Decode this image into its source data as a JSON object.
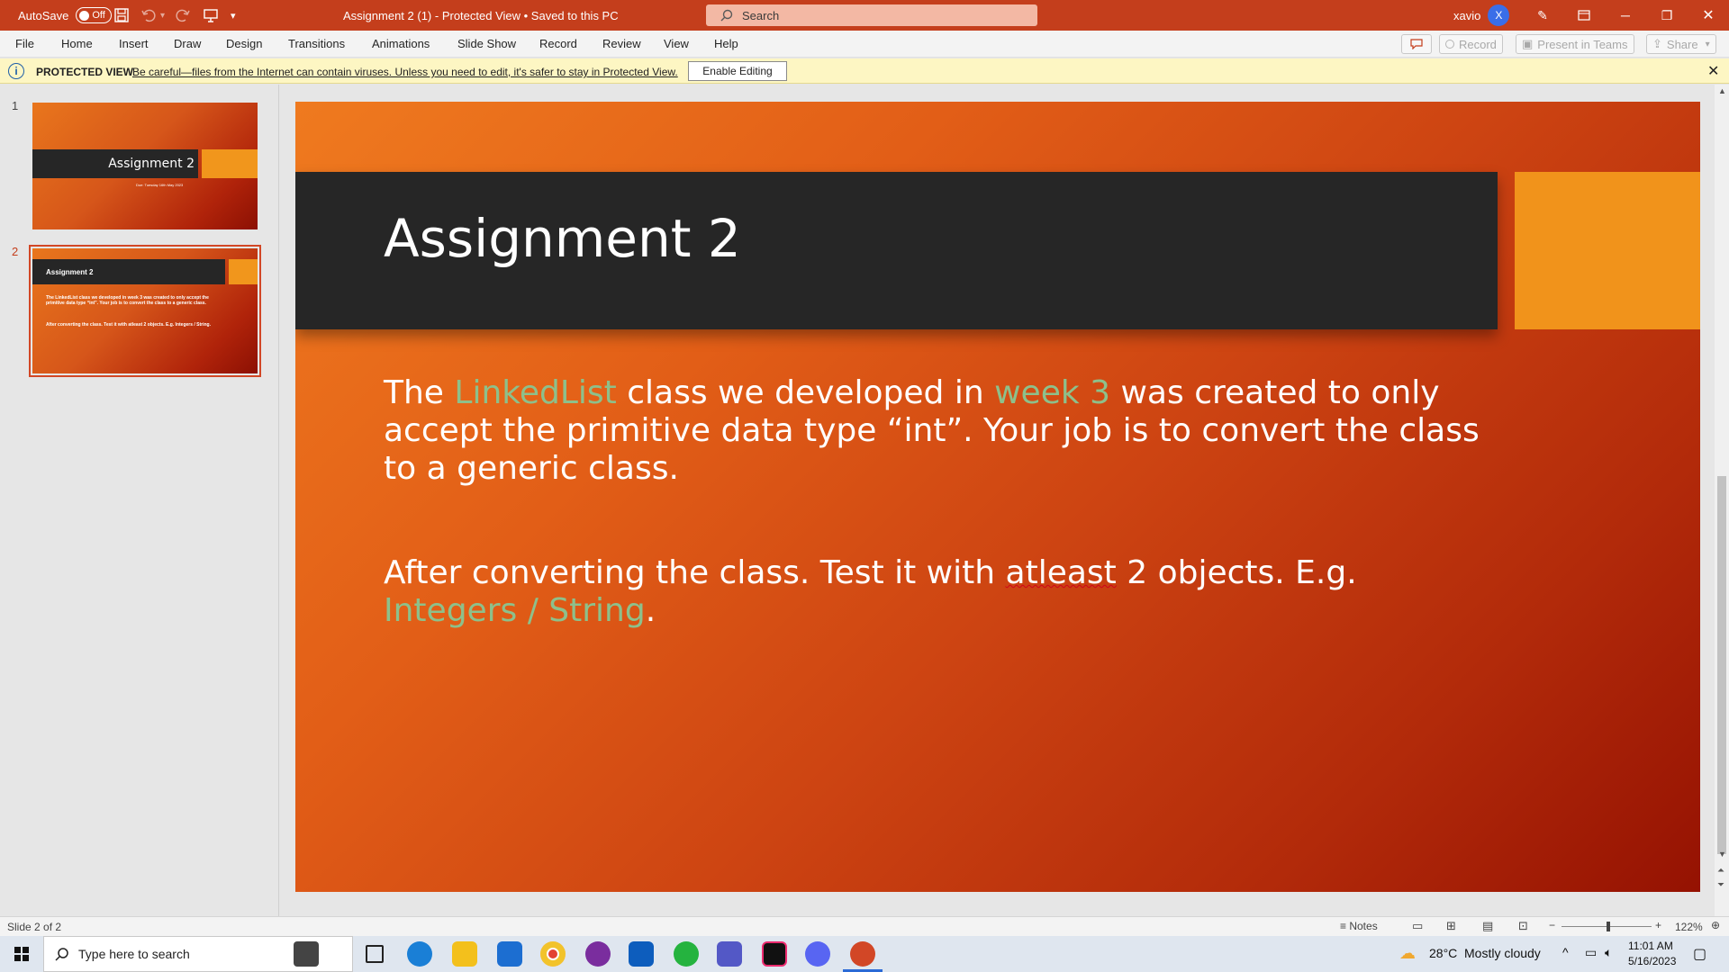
{
  "titlebar": {
    "autosave_label": "AutoSave",
    "autosave_state": "Off",
    "document_title": "Assignment 2 (1)  -  Protected View  •  Saved to this PC",
    "search_placeholder": "Search",
    "user_name": "xavio",
    "user_initial": "X"
  },
  "menu": {
    "items": [
      "File",
      "Home",
      "Insert",
      "Draw",
      "Design",
      "Transitions",
      "Animations",
      "Slide Show",
      "Record",
      "Review",
      "View",
      "Help"
    ],
    "record_button": "Record",
    "present_teams_button": "Present in Teams",
    "share_button": "Share"
  },
  "protected_view": {
    "title": "PROTECTED VIEW",
    "message": "Be careful—files from the Internet can contain viruses. Unless you need to edit, it's safer to stay in Protected View.",
    "enable_button": "Enable Editing"
  },
  "thumbnails": [
    {
      "number": "1",
      "title": "Assignment 2",
      "subtitle": "Due: Tuesday 16th May 2023"
    },
    {
      "number": "2",
      "title": "Assignment 2",
      "body1": "The LinkedList class we developed in week 3 was created to only accept the primitive data type “int”. Your job is to convert the class to a generic class.",
      "body2": "After converting the class. Test it with atleast 2 objects. E.g. Integers / String."
    }
  ],
  "slide": {
    "title": "Assignment 2",
    "p1": {
      "t1": "The ",
      "h1": "LinkedList",
      "t2": " class we developed in ",
      "h2": "week 3",
      "t3": " was created to only accept the primitive data type “int”. Your job is to convert the class to a generic class."
    },
    "p2": {
      "t1": "After converting the class. Test it with ",
      "u1": "atleast",
      "t2": " 2 objects. E.g. ",
      "h1": "Integers / String",
      "t3": "."
    }
  },
  "statusbar": {
    "slide_info": "Slide 2 of 2",
    "notes": "Notes",
    "zoom": "122%"
  },
  "taskbar": {
    "search_placeholder": "Type here to search",
    "temperature": "28°C",
    "weather": "Mostly cloudy",
    "time": "11:01 AM",
    "date": "5/16/2023"
  },
  "colors": {
    "titlebar": "#c43e1c",
    "highlight_text": "#8dc08b",
    "title_band": "#262626",
    "accent_tab": "#f1931b"
  }
}
